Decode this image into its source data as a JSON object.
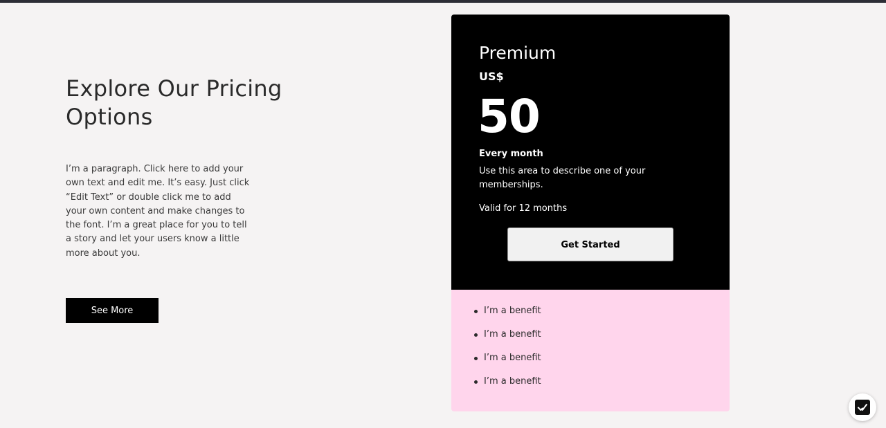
{
  "hero": {
    "title": "Explore Our Pricing Options",
    "paragraph": "I’m a paragraph. Click here to add your own text and edit me. It’s easy. Just click “Edit Text” or double click me to add your own content and make changes to the font. I’m a great place for you to tell a story and let your users know a little more about you.",
    "see_more_label": "See More"
  },
  "plan": {
    "name": "Premium",
    "currency": "US$",
    "price": "50",
    "period": "Every month",
    "description": "Use this area to describe one of your memberships.",
    "validity": "Valid for 12 months",
    "cta_label": "Get Started",
    "benefits": [
      "I’m a benefit",
      "I’m a benefit",
      "I’m a benefit",
      "I’m a benefit"
    ]
  },
  "colors": {
    "page_background": "#f5f3f3",
    "card_top": "#000000",
    "card_bottom": "#ffd5ec",
    "top_bar": "#2d2e36"
  },
  "icons": {
    "chat_widget": "checkmark-chat-icon"
  }
}
